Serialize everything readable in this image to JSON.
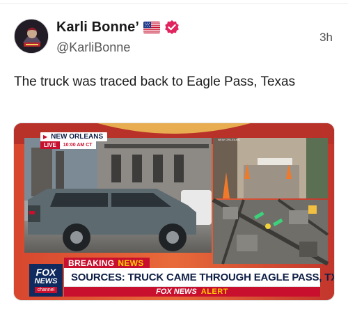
{
  "post": {
    "author": {
      "display_name": "Karli Bonne’",
      "handle": "@KarliBonne",
      "flag_icon": "us-flag-icon",
      "verified_icon": "verified-badge-icon",
      "verified_color": "#e0245e"
    },
    "timestamp": "3h",
    "text": "The truck was traced back to Eagle Pass, Texas"
  },
  "media": {
    "location_tag": "NEW ORLEANS",
    "live_label": "LIVE",
    "live_time": "10:00 AM CT",
    "inset_label": "NEW ORLEANS",
    "breaking_word": "BREAKING",
    "breaking_news": "NEWS",
    "headline": "SOURCES: TRUCK CAME THROUGH EAGLE PASS, TX",
    "alert_brand": "FOX NEWS",
    "alert_word": "ALERT",
    "logo": {
      "line1": "FOX",
      "line2": "NEWS",
      "line3": "channel"
    },
    "colors": {
      "fox_red": "#c8102e",
      "fox_navy": "#0f1f46",
      "alert_yellow": "#ffcc00"
    }
  }
}
